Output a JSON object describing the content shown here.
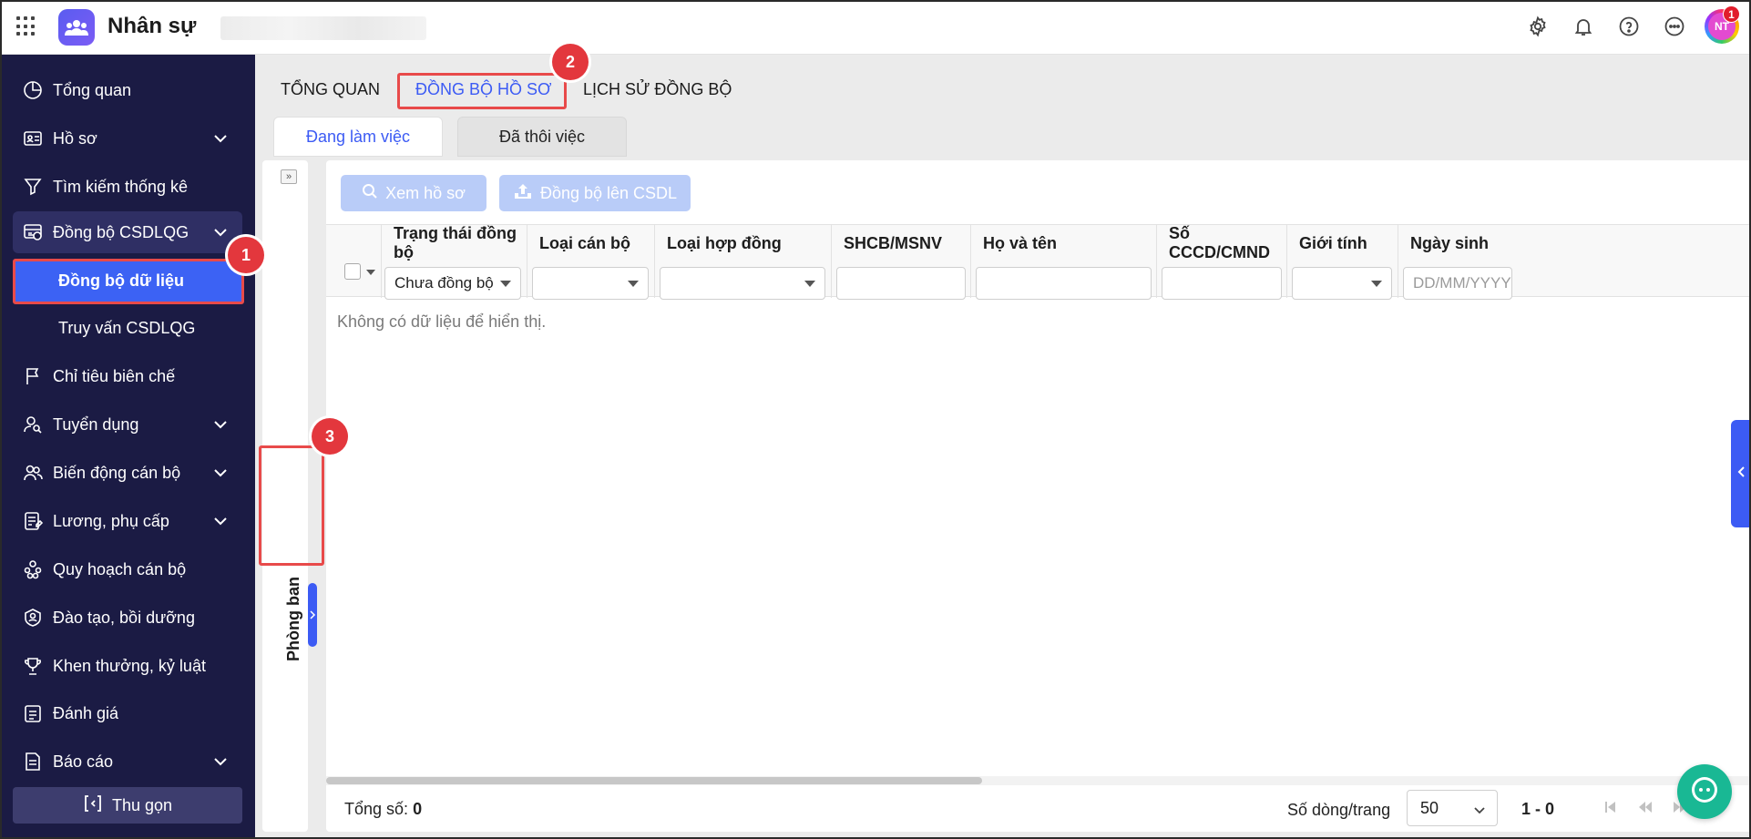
{
  "app": {
    "title": "Nhân sự",
    "avatar_initials": "NT",
    "notification_count": "1"
  },
  "sidebar": {
    "items": [
      {
        "label": "Tổng quan"
      },
      {
        "label": "Hồ sơ"
      },
      {
        "label": "Tìm kiếm thống kê"
      },
      {
        "label": "Đồng bộ CSDLQG"
      },
      {
        "label": "Chỉ tiêu biên chế"
      },
      {
        "label": "Tuyển dụng"
      },
      {
        "label": "Biến động cán bộ"
      },
      {
        "label": "Lương, phụ cấp"
      },
      {
        "label": "Quy hoạch cán bộ"
      },
      {
        "label": "Đào tạo, bồi dưỡng"
      },
      {
        "label": "Khen thưởng, kỷ luật"
      },
      {
        "label": "Đánh giá"
      },
      {
        "label": "Báo cáo"
      }
    ],
    "sub_items": [
      {
        "label": "Đồng bộ dữ liệu"
      },
      {
        "label": "Truy vấn CSDLQG"
      }
    ],
    "collapse_label": "Thu gọn"
  },
  "tabs": [
    "TỔNG QUAN",
    "ĐỒNG BỘ HỒ SƠ",
    "LỊCH SỬ ĐỒNG BỘ"
  ],
  "subtabs": [
    "Đang làm việc",
    "Đã thôi việc"
  ],
  "markers": [
    "1",
    "2",
    "3"
  ],
  "left_panel": {
    "label": "Phòng ban"
  },
  "toolbar": {
    "view_label": "Xem hồ sơ",
    "sync_label": "Đồng bộ lên CSDL"
  },
  "table": {
    "columns": [
      "Trạng thái đồng bộ",
      "Loại cán bộ",
      "Loại hợp đồng",
      "SHCB/MSNV",
      "Họ và tên",
      "Số CCCD/CMND",
      "Giới tính",
      "Ngày sinh"
    ],
    "filters": {
      "status_value": "Chưa đồng bộ",
      "dob_placeholder": "DD/MM/YYYY"
    },
    "empty_text": "Không có dữ liệu để hiển thị."
  },
  "footer": {
    "total_label": "Tổng số:",
    "total_value": "0",
    "rows_label": "Số dòng/trang",
    "rows_value": "50",
    "range": "1 - 0"
  },
  "colors": {
    "sidebar_bg": "#1b1b44",
    "accent": "#3c5bf4",
    "highlight": "#e84a4a",
    "chat": "#19b894"
  }
}
